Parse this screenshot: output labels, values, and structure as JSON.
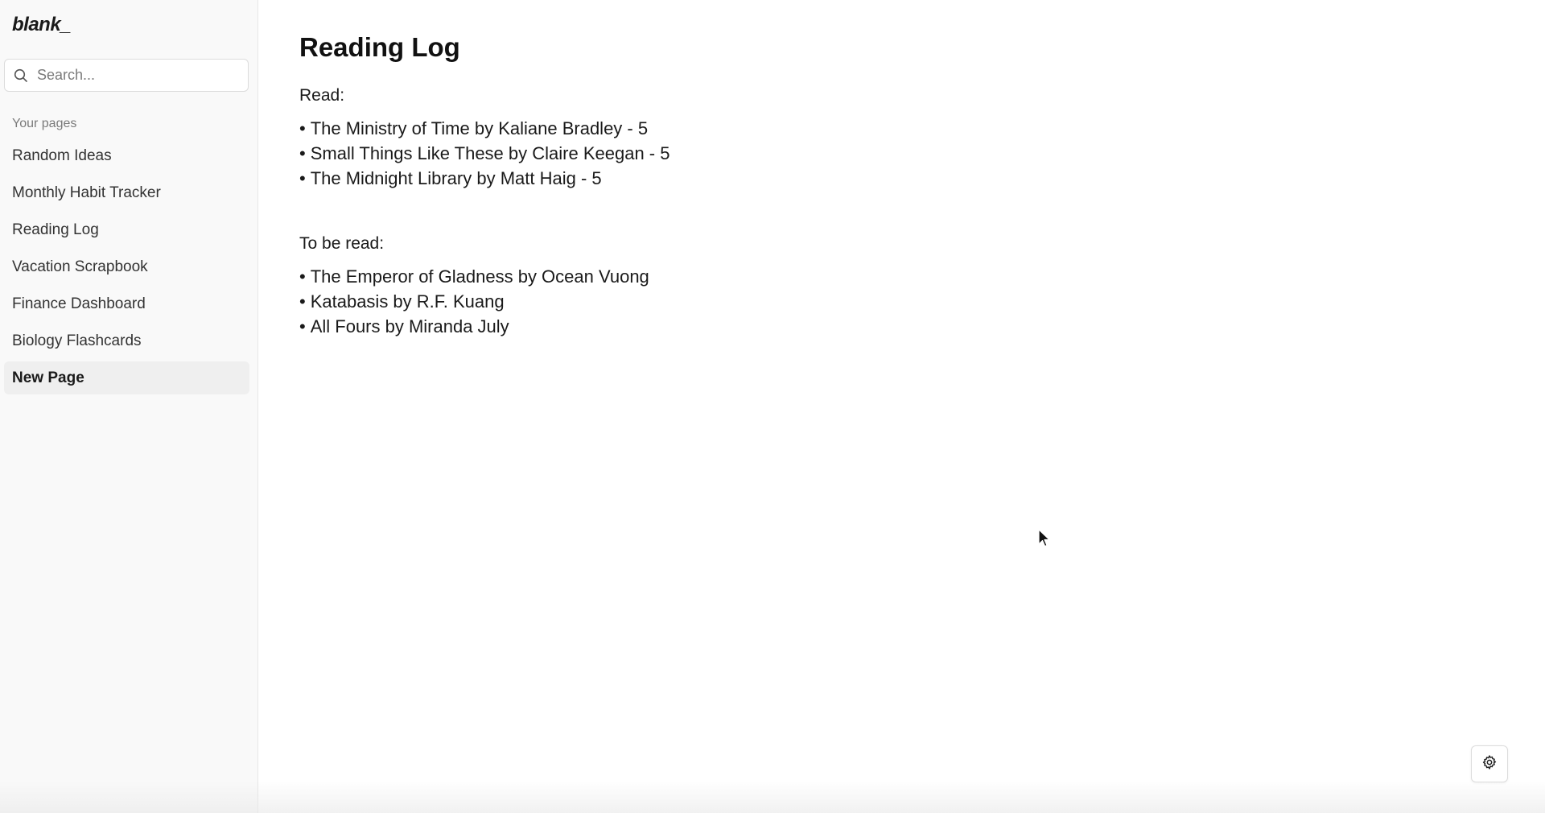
{
  "app": {
    "logo": "blank_"
  },
  "sidebar": {
    "search_placeholder": "Search...",
    "section_label": "Your pages",
    "items": [
      {
        "label": "Random Ideas"
      },
      {
        "label": "Monthly Habit Tracker"
      },
      {
        "label": "Reading Log"
      },
      {
        "label": "Vacation Scrapbook"
      },
      {
        "label": "Finance Dashboard"
      },
      {
        "label": "Biology Flashcards"
      },
      {
        "label": "New Page"
      }
    ]
  },
  "main": {
    "title": "Reading Log",
    "read_heading": "Read:",
    "read_items": [
      "The Ministry of Time by Kaliane Bradley - 5",
      "Small Things Like These by Claire Keegan - 5",
      "The Midnight Library by Matt Haig - 5"
    ],
    "tbr_heading": "To be read:",
    "tbr_items": [
      "The Emperor of Gladness by Ocean Vuong",
      "Katabasis by R.F. Kuang",
      "All Fours by Miranda July"
    ],
    "bullet": "•"
  },
  "icons": {
    "search": "search-icon",
    "settings": "gear-icon",
    "cursor": "mouse-pointer-icon"
  },
  "colors": {
    "sidebar_bg": "#f9f9f9",
    "active_item_bg": "#efefef",
    "text": "#1a1a1a",
    "muted_text": "#7a7a7a"
  }
}
